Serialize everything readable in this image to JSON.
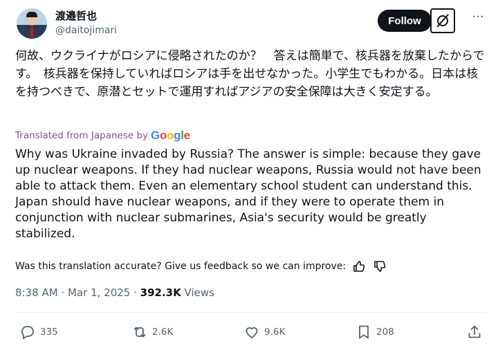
{
  "author": {
    "display_name": "渡邉哲也",
    "handle": "@daitojimari"
  },
  "header": {
    "follow_label": "Follow",
    "more_label": "···"
  },
  "post": {
    "original_text": "何故、ウクライナがロシアに侵略されたのか？　答えは簡単で、核兵器を放棄したからです。　核兵器を保持していればロシアは手を出せなかった。小学生でもわかる。日本は核を持つべきで、原潜とセットで運用すればアジアの安全保障は大きく安定する。",
    "translated_from": "Translated from Japanese by",
    "translator_brand": "Google",
    "translated_text": "Why was Ukraine invaded by Russia? The answer is simple: because they gave up nuclear weapons. If they had nuclear weapons, Russia would not have been able to attack them. Even an elementary school student can understand this. Japan should have nuclear weapons, and if they were to operate them in conjunction with nuclear submarines, Asia's security would be greatly stabilized.",
    "feedback_prompt": "Was this translation accurate? Give us feedback so we can improve:",
    "time": "8:38 AM",
    "separator": "·",
    "date": "Mar 1, 2025",
    "views_count": "392.3K",
    "views_label": "Views"
  },
  "actions": {
    "replies": "335",
    "reposts": "2.6K",
    "likes": "9.6K",
    "bookmarks": "208"
  },
  "colors": {
    "text": "#0f1419",
    "muted": "#536471",
    "translated_label": "#8a4e8c",
    "google_blue": "#4285F4",
    "google_red": "#EA4335",
    "google_yellow": "#FBBC05",
    "google_green": "#34A853"
  }
}
